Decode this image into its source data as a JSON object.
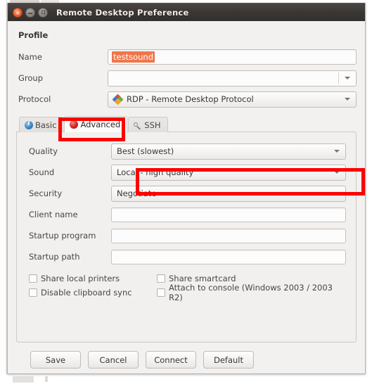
{
  "window": {
    "title": "Remote Desktop Preference",
    "controls": {
      "close_label": "close-button",
      "minimize_label": "minimize-button",
      "maximize_label": "maximize-button"
    }
  },
  "profile": {
    "heading": "Profile",
    "fields": [
      {
        "label": "Name",
        "type": "entry",
        "value": "testsound",
        "selected": true
      },
      {
        "label": "Group",
        "type": "combo-entry",
        "value": ""
      },
      {
        "label": "Protocol",
        "type": "combo",
        "value": "RDP - Remote Desktop Protocol",
        "icon": "rdp-icon"
      }
    ]
  },
  "tabs": [
    {
      "id": "basic",
      "label": "Basic",
      "icon": "info-icon",
      "active": false
    },
    {
      "id": "advanced",
      "label": "Advanced",
      "icon": "alert-icon",
      "active": true
    },
    {
      "id": "ssh",
      "label": "SSH",
      "icon": "key-icon",
      "active": false
    }
  ],
  "advanced": {
    "combos": [
      {
        "label": "Quality",
        "value": "Best (slowest)"
      },
      {
        "label": "Sound",
        "value": "Local - high quality"
      },
      {
        "label": "Security",
        "value": "Negotiate"
      }
    ],
    "entries": [
      {
        "label": "Client name",
        "value": ""
      },
      {
        "label": "Startup program",
        "value": ""
      },
      {
        "label": "Startup path",
        "value": ""
      }
    ],
    "checkboxes": [
      {
        "label": "Share local printers",
        "checked": false
      },
      {
        "label": "Share smartcard",
        "checked": false
      },
      {
        "label": "Disable clipboard sync",
        "checked": false
      },
      {
        "label": "Attach to console (Windows 2003 / 2003 R2)",
        "checked": false
      }
    ]
  },
  "buttons": [
    {
      "id": "save",
      "label": "Save"
    },
    {
      "id": "cancel",
      "label": "Cancel"
    },
    {
      "id": "connect",
      "label": "Connect"
    },
    {
      "id": "default",
      "label": "Default"
    }
  ],
  "annotations": {
    "color": "#fc0000",
    "highlights": [
      {
        "target": "tab-advanced",
        "note": "Advanced tab highlighted"
      },
      {
        "target": "sound-dropdown",
        "note": "Sound dropdown highlighted"
      }
    ]
  },
  "colors": {
    "titlebar_bg": "#3b3735",
    "window_bg": "#f2f1f0",
    "selection_orange": "#f0764a",
    "annotation_red": "#fc0000"
  }
}
